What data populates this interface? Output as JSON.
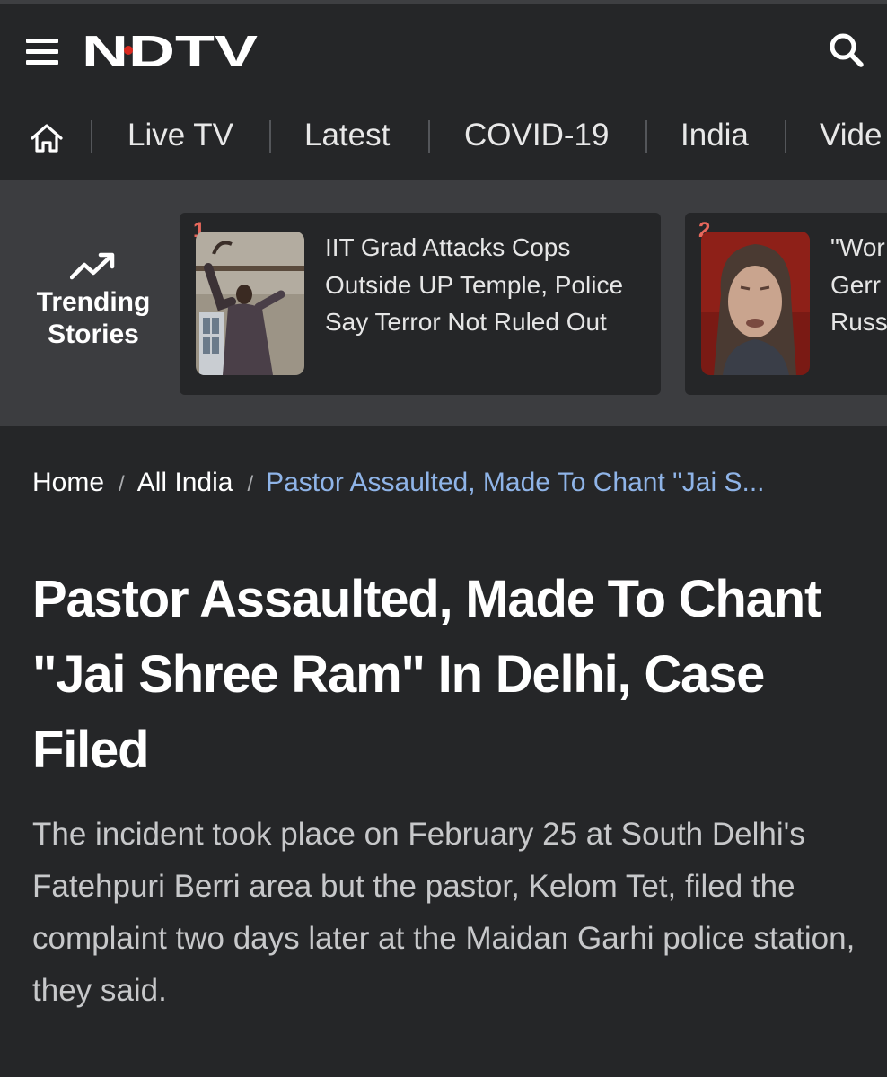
{
  "header": {
    "logo_text": "NDTV"
  },
  "nav": {
    "items": [
      "Live TV",
      "Latest",
      "COVID-19",
      "India",
      "Vide"
    ]
  },
  "trending": {
    "label_line1": "Trending",
    "label_line2": "Stories",
    "cards": [
      {
        "rank": "1",
        "title": "IIT Grad Attacks Cops Outside UP Temple, Police Say Terror Not Ruled Out"
      },
      {
        "rank": "2",
        "title": "\"Wor Gerr Russ"
      }
    ]
  },
  "breadcrumb": {
    "home": "Home",
    "section": "All India",
    "current": "Pastor Assaulted, Made To Chant \"Jai S..."
  },
  "article": {
    "headline": "Pastor Assaulted, Made To Chant \"Jai Shree Ram\" In Delhi, Case Filed",
    "summary": "The incident took place on February 25 at South Delhi's Fatehpuri Berri area but the pastor, Kelom Tet, filed the complaint two days later at the Maidan Garhi police station, they said."
  },
  "colors": {
    "background": "#252628",
    "trending_band": "#3c3d40",
    "accent_red": "#e8685c",
    "breadcrumb_link": "#8fb4e8"
  }
}
